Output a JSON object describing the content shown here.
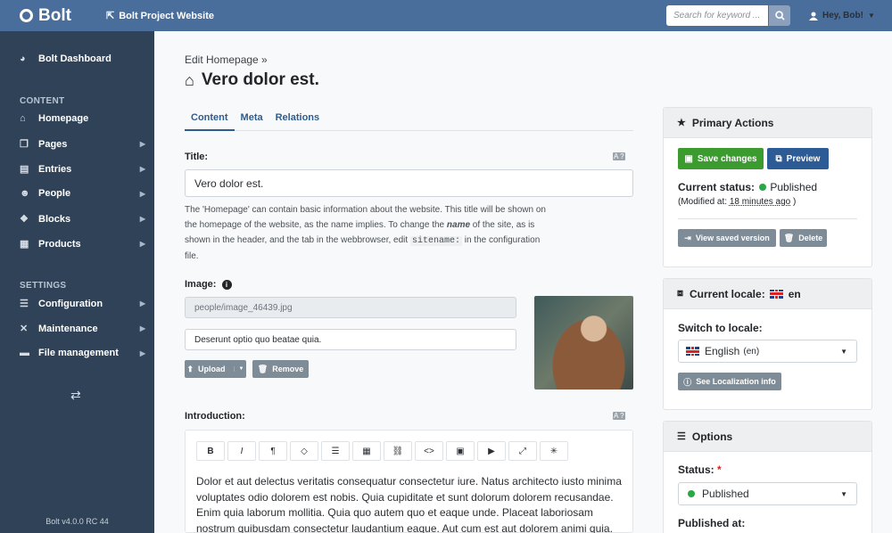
{
  "topbar": {
    "brand": "Bolt",
    "site_link": "Bolt Project Website",
    "search_placeholder": "Search for keyword ...",
    "user": "Hey, Bob!"
  },
  "sidebar": {
    "dashboard": "Bolt Dashboard",
    "content_heading": "CONTENT",
    "content_items": [
      {
        "label": "Homepage",
        "icon": "home-icon"
      },
      {
        "label": "Pages",
        "icon": "copy-icon"
      },
      {
        "label": "Entries",
        "icon": "file-icon"
      },
      {
        "label": "People",
        "icon": "users-icon"
      },
      {
        "label": "Blocks",
        "icon": "cubes-icon"
      },
      {
        "label": "Products",
        "icon": "boxes-icon"
      }
    ],
    "settings_heading": "SETTINGS",
    "settings_items": [
      {
        "label": "Configuration",
        "icon": "sliders-icon"
      },
      {
        "label": "Maintenance",
        "icon": "tools-icon"
      },
      {
        "label": "File management",
        "icon": "folder-icon"
      }
    ],
    "version": "Bolt v4.0.0 RC 44"
  },
  "main": {
    "breadcrumb": "Edit Homepage »",
    "title": "Vero dolor est.",
    "tabs": [
      "Content",
      "Meta",
      "Relations"
    ],
    "title_label": "Title:",
    "title_value": "Vero dolor est.",
    "help_part1": "The 'Homepage' can contain basic information about the website. This title will be shown on the homepage of the website, as the name implies. To change the ",
    "help_em": "name",
    "help_part2": " of the site, as is shown in the header, and the tab in the webbrowser, edit ",
    "help_code": "sitename:",
    "help_part3": " in the configuration file.",
    "image_label": "Image:",
    "image_path": "people/image_46439.jpg",
    "image_alt": "Deserunt optio quo beatae quia.",
    "upload_label": "Upload",
    "remove_label": "Remove",
    "intro_label": "Introduction:",
    "editor_buttons": [
      "B",
      "I",
      "¶",
      "◇",
      "☰",
      "▦",
      "⛓",
      "<>",
      "▣",
      "▶",
      "⤢",
      "✳"
    ],
    "intro_text": "Dolor et aut delectus veritatis consequatur consectetur iure. Natus architecto iusto minima voluptates odio dolorem est nobis. Quia cupiditate et sunt dolorum dolorem recusandae. Enim quia laborum mollitia. Quia quo autem quo et eaque unde. Placeat laboriosam nostrum quibusdam consectetur laudantium eaque. Aut cum est aut dolorem animi quia."
  },
  "primary_actions": {
    "heading": "Primary Actions",
    "save_label": "Save changes",
    "preview_label": "Preview",
    "status_label": "Current status:",
    "status_value": "Published",
    "modified_prefix": "(Modified at: ",
    "modified_value": "18 minutes ago",
    "modified_suffix": " )",
    "view_saved_label": "View saved version",
    "delete_label": "Delete"
  },
  "locale": {
    "heading": "Current locale:",
    "current": "en",
    "switch_label": "Switch to locale:",
    "selected": "English",
    "selected_code": "(en)",
    "info_label": "See Localization info"
  },
  "options": {
    "heading": "Options",
    "status_label": "Status:",
    "required_mark": "*",
    "status_value": "Published",
    "published_at_label": "Published at:"
  },
  "colors": {
    "topbar": "#4a6e9b",
    "sidebar": "#2f4257",
    "save": "#3b9b2e",
    "preview": "#2d5b96",
    "status_green": "#28a745"
  }
}
